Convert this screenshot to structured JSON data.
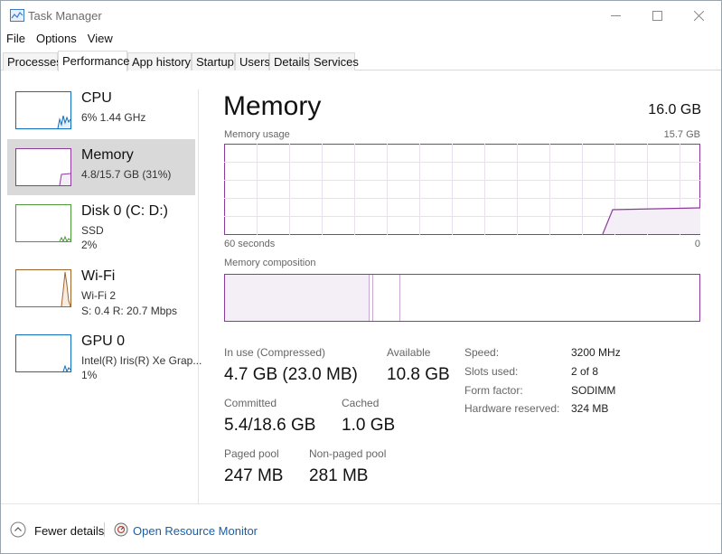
{
  "window": {
    "title": "Task Manager"
  },
  "menu": [
    "File",
    "Options",
    "View"
  ],
  "tabs": [
    "Processes",
    "Performance",
    "App history",
    "Startup",
    "Users",
    "Details",
    "Services"
  ],
  "sidebar": {
    "items": [
      {
        "name": "CPU",
        "line1": "6%  1.44 GHz",
        "line2": ""
      },
      {
        "name": "Memory",
        "line1": "4.8/15.7 GB (31%)",
        "line2": ""
      },
      {
        "name": "Disk 0 (C: D:)",
        "line1": "SSD",
        "line2": "2%"
      },
      {
        "name": "Wi-Fi",
        "line1": "Wi-Fi 2",
        "line2": "S: 0.4  R: 20.7 Mbps"
      },
      {
        "name": "GPU 0",
        "line1": "Intel(R) Iris(R) Xe Grap...",
        "line2": "1%"
      }
    ]
  },
  "main": {
    "title": "Memory",
    "total": "16.0 GB",
    "usage_label": "Memory usage",
    "usage_max": "15.7 GB",
    "time_left": "60 seconds",
    "time_right": "0",
    "composition_label": "Memory composition",
    "stats": {
      "in_use_label": "In use (Compressed)",
      "in_use_value": "4.7 GB (23.0 MB)",
      "available_label": "Available",
      "available_value": "10.8 GB",
      "committed_label": "Committed",
      "committed_value": "5.4/18.6 GB",
      "cached_label": "Cached",
      "cached_value": "1.0 GB",
      "paged_label": "Paged pool",
      "paged_value": "247 MB",
      "nonpaged_label": "Non-paged pool",
      "nonpaged_value": "281 MB"
    },
    "specs": {
      "speed_label": "Speed:",
      "speed_value": "3200 MHz",
      "slots_label": "Slots used:",
      "slots_value": "2 of 8",
      "form_label": "Form factor:",
      "form_value": "SODIMM",
      "reserved_label": "Hardware reserved:",
      "reserved_value": "324 MB"
    }
  },
  "footer": {
    "fewer_details": "Fewer details",
    "open_resource_monitor": "Open Resource Monitor"
  },
  "colors": {
    "memory_accent": "#8b3a9c",
    "memory_fill": "#f4eff7",
    "selected_item": "#d9d9d9",
    "link": "#1a5fa8"
  }
}
